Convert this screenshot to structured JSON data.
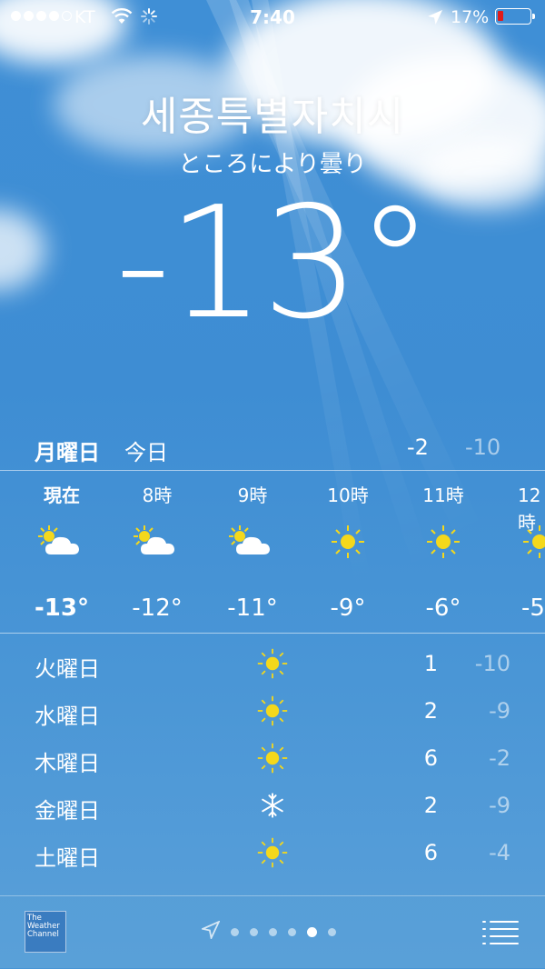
{
  "status_bar": {
    "carrier": "KT",
    "time": "7:40",
    "battery_percent": "17%",
    "signal_dots_filled": 4,
    "signal_dots_total": 5
  },
  "location": {
    "city": "세종특별자치시",
    "condition": "ところにより曇り",
    "temperature": "-13°"
  },
  "today": {
    "day": "月曜日",
    "label": "今日",
    "high": "-2",
    "low": "-10"
  },
  "hourly": [
    {
      "time": "現在",
      "icon": "partly-cloudy-icon",
      "temp": "-13°"
    },
    {
      "time": "8時",
      "icon": "partly-cloudy-icon",
      "temp": "-12°"
    },
    {
      "time": "9時",
      "icon": "partly-cloudy-icon",
      "temp": "-11°"
    },
    {
      "time": "10時",
      "icon": "sun-icon",
      "temp": "-9°"
    },
    {
      "time": "11時",
      "icon": "sun-icon",
      "temp": "-6°"
    },
    {
      "time": "12時",
      "icon": "sun-icon",
      "temp": "-5"
    }
  ],
  "daily": [
    {
      "day": "火曜日",
      "icon": "sun-icon",
      "high": "1",
      "low": "-10"
    },
    {
      "day": "水曜日",
      "icon": "sun-icon",
      "high": "2",
      "low": "-9"
    },
    {
      "day": "木曜日",
      "icon": "sun-icon",
      "high": "6",
      "low": "-2"
    },
    {
      "day": "金曜日",
      "icon": "snowflake-icon",
      "high": "2",
      "low": "-9"
    },
    {
      "day": "土曜日",
      "icon": "sun-icon",
      "high": "6",
      "low": "-4"
    }
  ],
  "footer": {
    "logo_text": "The Weather Channel",
    "page_count": 6,
    "current_page": 5
  },
  "colors": {
    "sky": "#3f8fd6",
    "sun_yellow": "#f4d81c",
    "battery_low": "#e01b1b"
  }
}
